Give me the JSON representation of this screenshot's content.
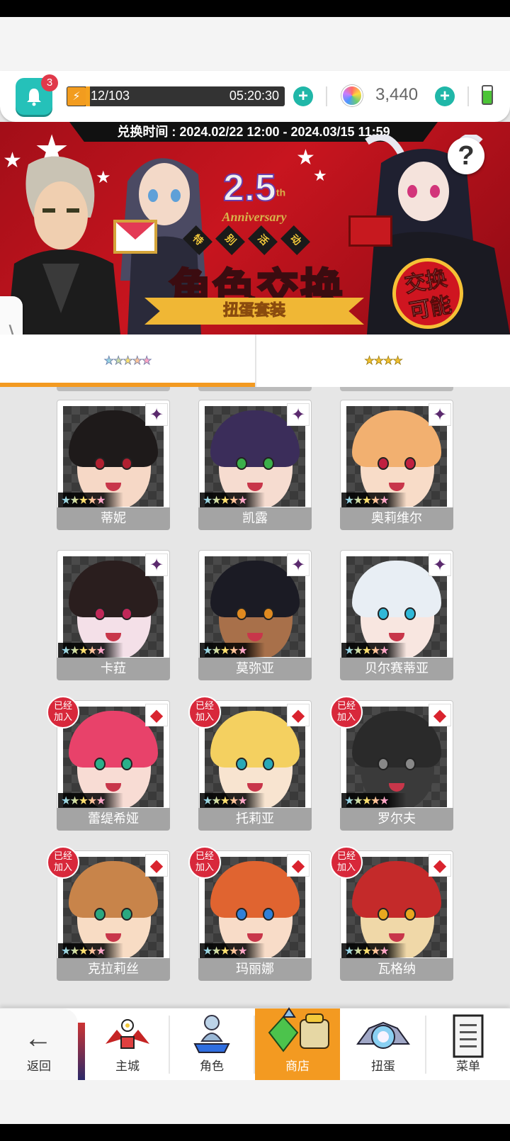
{
  "status": {
    "notifications": "3",
    "stamina": "12/103",
    "stamina_timer": "05:20:30",
    "gems": "3,440"
  },
  "banner": {
    "exchange_period": "兑换时间 : 2024.02/22 12:00 - 2024.03/15 11:59",
    "anniv_number": "2.5",
    "anniv_sup": "th",
    "anniv_text": "Anniversary",
    "event_tags": [
      "特",
      "别",
      "活",
      "动"
    ],
    "title": "角色交换",
    "subtitle": "扭蛋套装",
    "seal_line1": "交换",
    "seal_line2": "可能",
    "help": "?"
  },
  "tabs": [
    {
      "stars": "★★★★★",
      "rarity": 5,
      "active": true
    },
    {
      "stars": "★★★★",
      "rarity": 4,
      "active": false
    }
  ],
  "characters": [
    {
      "name": "蒂妮",
      "element": "dark",
      "joined": false,
      "stars": "★★★★★"
    },
    {
      "name": "凯露",
      "element": "dark",
      "joined": false,
      "stars": "★★★★★"
    },
    {
      "name": "奥莉维尔",
      "element": "dark",
      "joined": false,
      "stars": "★★★★★"
    },
    {
      "name": "卡菈",
      "element": "dark",
      "joined": false,
      "stars": "★★★★★"
    },
    {
      "name": "莫弥亚",
      "element": "dark",
      "joined": false,
      "stars": "★★★★★"
    },
    {
      "name": "贝尔赛蒂亚",
      "element": "dark",
      "joined": false,
      "stars": "★★★★★"
    },
    {
      "name": "蕾缇希娅",
      "element": "fire",
      "joined": true,
      "stars": "★★★★★"
    },
    {
      "name": "托莉亚",
      "element": "fire",
      "joined": true,
      "stars": "★★★★★"
    },
    {
      "name": "罗尔夫",
      "element": "fire",
      "joined": true,
      "stars": "★★★★★"
    },
    {
      "name": "克拉莉丝",
      "element": "fire",
      "joined": true,
      "stars": "★★★★★"
    },
    {
      "name": "玛丽娜",
      "element": "fire",
      "joined": true,
      "stars": "★★★★★"
    },
    {
      "name": "瓦格纳",
      "element": "fire",
      "joined": true,
      "stars": "★★★★★"
    }
  ],
  "joined_label": "已经\n加入",
  "nav": {
    "back": "返回",
    "items": [
      {
        "label": "主城",
        "icon": "castle-icon",
        "active": false
      },
      {
        "label": "角色",
        "icon": "character-icon",
        "active": false
      },
      {
        "label": "商店",
        "icon": "shop-icon",
        "active": true
      },
      {
        "label": "扭蛋",
        "icon": "gacha-icon",
        "active": false
      },
      {
        "label": "菜单",
        "icon": "menu-icon",
        "active": false
      }
    ]
  },
  "colors": {
    "accent": "#f39a21",
    "teal": "#25c1b9",
    "banner_red": "#c8151f",
    "nameplate": "#a4a4a4",
    "joined_badge": "#d8283b"
  }
}
